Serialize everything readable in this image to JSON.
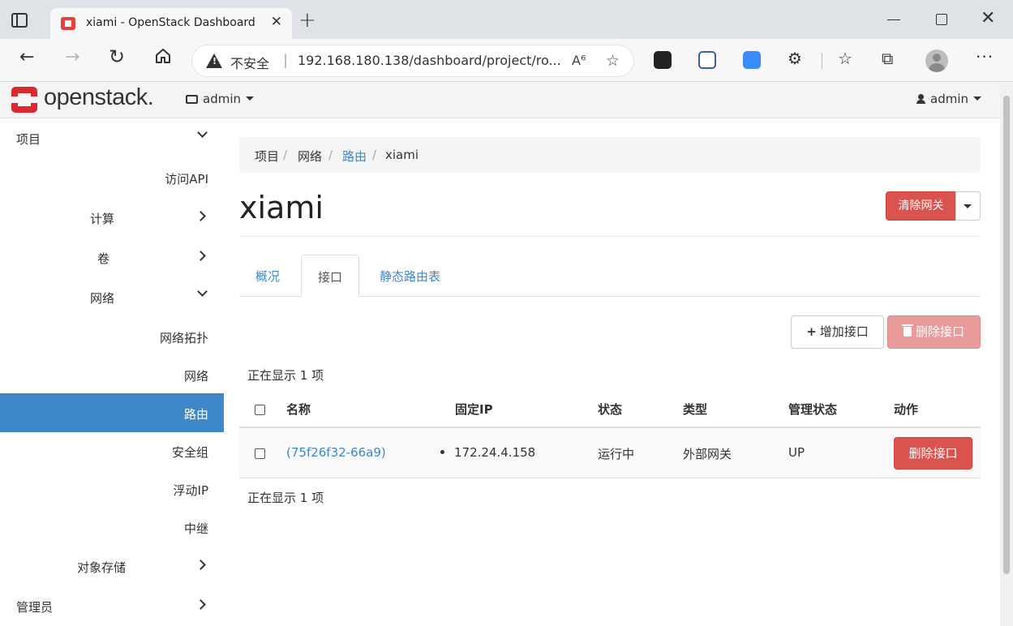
{
  "browser": {
    "tab_title": "xiami - OpenStack Dashboard",
    "security_label": "不安全",
    "url": "192.168.180.138/dashboard/project/ro...",
    "new_tab_glyph": "+",
    "close_glyph": "✕"
  },
  "header": {
    "logo_text": "openstack.",
    "project_name": "admin",
    "user_name": "admin"
  },
  "sidebar": {
    "items": [
      {
        "label": "项目",
        "expanded": true
      },
      {
        "label": "访问API"
      },
      {
        "label": "计算"
      },
      {
        "label": "卷"
      },
      {
        "label": "网络",
        "expanded": true
      },
      {
        "label": "网络拓扑"
      },
      {
        "label": "网络"
      },
      {
        "label": "路由",
        "active": true
      },
      {
        "label": "安全组"
      },
      {
        "label": "浮动IP"
      },
      {
        "label": "中继"
      },
      {
        "label": "对象存储"
      },
      {
        "label": "管理员"
      }
    ]
  },
  "breadcrumb": [
    "项目",
    "网络",
    "路由",
    "xiami"
  ],
  "page": {
    "title": "xiami",
    "clear_gateway_label": "清除网关"
  },
  "tabs": [
    "概况",
    "接口",
    "静态路由表"
  ],
  "active_tab": "接口",
  "actions": {
    "add_interface_label": "增加接口",
    "delete_interfaces_label": "删除接口"
  },
  "table": {
    "count_label": "正在显示 1 项",
    "columns": [
      "名称",
      "固定IP",
      "状态",
      "类型",
      "管理状态",
      "动作"
    ],
    "rows": [
      {
        "name": "(75f26f32-66a9)",
        "fixed_ip": "172.24.4.158",
        "status": "运行中",
        "type": "外部网关",
        "admin_state": "UP",
        "action_label": "删除接口"
      }
    ]
  },
  "colors": {
    "accent": "#3e87c9",
    "danger": "#d9534f",
    "brand": "#d9282f"
  }
}
